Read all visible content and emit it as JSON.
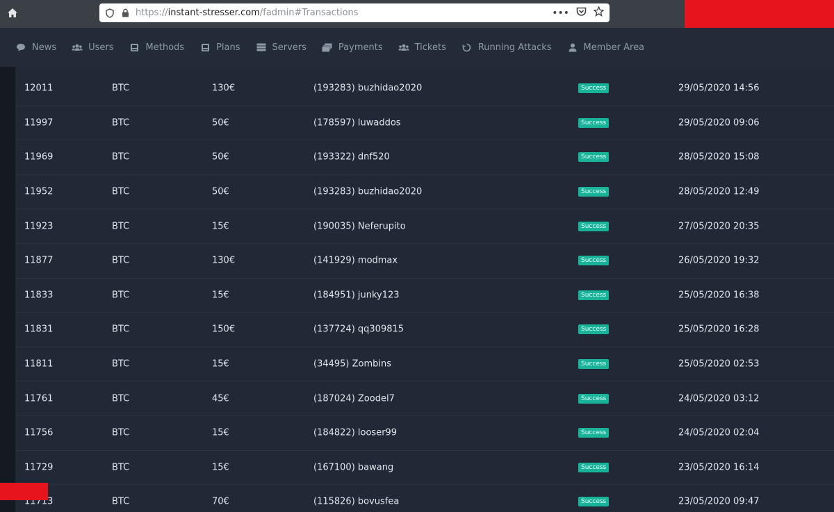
{
  "browser": {
    "url_scheme": "https://",
    "url_host": "instant-stresser.com",
    "url_path": "/fadmin#Transactions",
    "more_glyph": "•••"
  },
  "nav": [
    {
      "label": "News",
      "icon": "comment-icon"
    },
    {
      "label": "Users",
      "icon": "users-icon"
    },
    {
      "label": "Methods",
      "icon": "book-icon"
    },
    {
      "label": "Plans",
      "icon": "book-icon"
    },
    {
      "label": "Servers",
      "icon": "server-icon"
    },
    {
      "label": "Payments",
      "icon": "money-icon"
    },
    {
      "label": "Tickets",
      "icon": "users-icon"
    },
    {
      "label": "Running Attacks",
      "icon": "spinner-icon"
    },
    {
      "label": "Member Area",
      "icon": "user-icon"
    }
  ],
  "transactions": [
    {
      "id": "12011",
      "method": "BTC",
      "amount": "130€",
      "user": "(193283) buzhidao2020",
      "status": "Success",
      "date": "29/05/2020 14:56"
    },
    {
      "id": "11997",
      "method": "BTC",
      "amount": "50€",
      "user": "(178597) luwaddos",
      "status": "Success",
      "date": "29/05/2020 09:06"
    },
    {
      "id": "11969",
      "method": "BTC",
      "amount": "50€",
      "user": "(193322) dnf520",
      "status": "Success",
      "date": "28/05/2020 15:08"
    },
    {
      "id": "11952",
      "method": "BTC",
      "amount": "50€",
      "user": "(193283) buzhidao2020",
      "status": "Success",
      "date": "28/05/2020 12:49"
    },
    {
      "id": "11923",
      "method": "BTC",
      "amount": "15€",
      "user": "(190035) Neferupito",
      "status": "Success",
      "date": "27/05/2020 20:35"
    },
    {
      "id": "11877",
      "method": "BTC",
      "amount": "130€",
      "user": "(141929) modmax",
      "status": "Success",
      "date": "26/05/2020 19:32"
    },
    {
      "id": "11833",
      "method": "BTC",
      "amount": "15€",
      "user": "(184951) junky123",
      "status": "Success",
      "date": "25/05/2020 16:38"
    },
    {
      "id": "11831",
      "method": "BTC",
      "amount": "150€",
      "user": "(137724) qq309815",
      "status": "Success",
      "date": "25/05/2020 16:28"
    },
    {
      "id": "11811",
      "method": "BTC",
      "amount": "15€",
      "user": "(34495) Zombins",
      "status": "Success",
      "date": "25/05/2020 02:53"
    },
    {
      "id": "11761",
      "method": "BTC",
      "amount": "45€",
      "user": "(187024) Zoodel7",
      "status": "Success",
      "date": "24/05/2020 03:12"
    },
    {
      "id": "11756",
      "method": "BTC",
      "amount": "15€",
      "user": "(184822) looser99",
      "status": "Success",
      "date": "24/05/2020 02:04"
    },
    {
      "id": "11729",
      "method": "BTC",
      "amount": "15€",
      "user": "(167100) bawang",
      "status": "Success",
      "date": "23/05/2020 16:14"
    },
    {
      "id": "11713",
      "method": "BTC",
      "amount": "70€",
      "user": "(115826) bovusfea",
      "status": "Success",
      "date": "23/05/2020 09:47"
    }
  ],
  "colors": {
    "background": "#1f2633",
    "status_success": "#19b39a",
    "redaction": "#e8141c"
  }
}
